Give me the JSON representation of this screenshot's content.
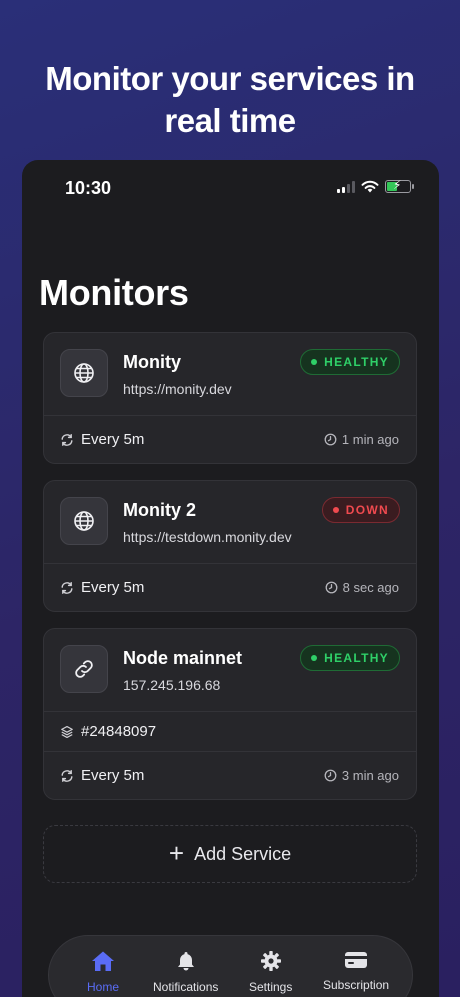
{
  "hero": {
    "title": "Monitor your services in real time"
  },
  "status_bar": {
    "time": "10:30"
  },
  "page": {
    "title": "Monitors"
  },
  "monitors": [
    {
      "name": "Monity",
      "url": "https://monity.dev",
      "icon": "globe-icon",
      "status": "HEALTHY",
      "interval": "Every 5m",
      "last_check": "1 min ago"
    },
    {
      "name": "Monity 2",
      "url": "https://testdown.monity.dev",
      "icon": "globe-icon",
      "status": "DOWN",
      "interval": "Every 5m",
      "last_check": "8 sec ago"
    },
    {
      "name": "Node mainnet",
      "url": "157.245.196.68",
      "icon": "link-icon",
      "status": "HEALTHY",
      "block": "#24848097",
      "interval": "Every 5m",
      "last_check": "3 min ago"
    }
  ],
  "add_service": {
    "label": "Add Service"
  },
  "tabs": [
    {
      "label": "Home",
      "icon": "house-icon",
      "active": true
    },
    {
      "label": "Notifications",
      "icon": "bell-icon",
      "active": false
    },
    {
      "label": "Settings",
      "icon": "gear-icon",
      "active": false
    },
    {
      "label": "Subscription",
      "icon": "credit-card-icon",
      "active": false
    }
  ],
  "colors": {
    "healthy": "#2fd068",
    "down": "#f04a4f",
    "accent": "#5a6cf5",
    "background": "#1c1c1f"
  }
}
